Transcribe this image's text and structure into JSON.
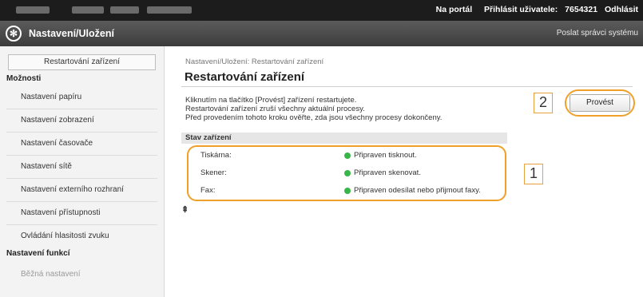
{
  "topbar": {
    "portal_link": "Na portál",
    "logged_user_label": "Přihlásit uživatele:",
    "user_id": "7654321",
    "logout_link": "Odhlásit"
  },
  "header": {
    "title": "Nastavení/Uložení",
    "mail_admin_link": "Poslat správci systému"
  },
  "sidebar": {
    "restart_link": "Restartování zařízení",
    "sections": [
      {
        "title": "Možnosti",
        "items": [
          "Nastavení papíru",
          "Nastavení zobrazení",
          "Nastavení časovače",
          "Nastavení sítě",
          "Nastavení externího rozhraní",
          "Nastavení přístupnosti",
          "Ovládání hlasitosti zvuku"
        ]
      },
      {
        "title": "Nastavení funkcí",
        "items": [
          "Běžná nastavení"
        ]
      }
    ]
  },
  "main": {
    "breadcrumb": "Nastavení/Uložení: Restartování zařízení",
    "title": "Restartování zařízení",
    "description": [
      "Kliknutím na tlačítko [Provést] zařízení restartujete.",
      "Restartování zařízení zruší všechny aktuální procesy.",
      "Před provedením tohoto kroku ověřte, zda jsou všechny procesy dokončeny."
    ],
    "execute_button": "Provést",
    "status": {
      "heading": "Stav zařízení",
      "rows": [
        {
          "label": "Tiskárna:",
          "value": "Připraven tisknout.",
          "color": "#3ab54a"
        },
        {
          "label": "Skener:",
          "value": "Připraven skenovat.",
          "color": "#3ab54a"
        },
        {
          "label": "Fax:",
          "value": "Připraven odesílat nebo přijmout faxy.",
          "color": "#3ab54a"
        }
      ]
    },
    "callouts": {
      "one": "1",
      "two": "2"
    },
    "to_top_icon": "to-top-icon",
    "to_top_glyph": "⇞"
  },
  "colors": {
    "topbar": "#1c1c1c",
    "header": "#4a4a4a",
    "highlight": "#f0a028",
    "status_ok": "#3ab54a"
  }
}
